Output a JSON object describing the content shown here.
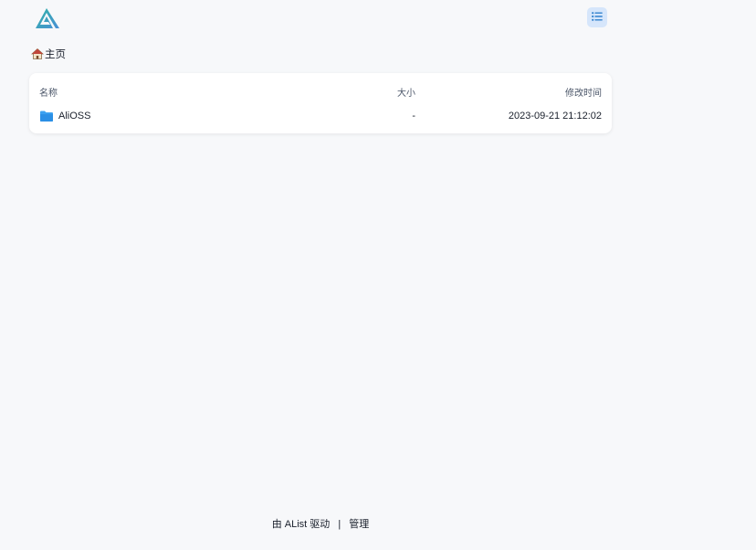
{
  "header": {
    "logo_icon": "alist-logo-icon",
    "layout_toggle_icon": "list-icon",
    "accent_color": "#3182ce"
  },
  "breadcrumb": {
    "home_icon": "house-emoji-icon",
    "home_label": "主页"
  },
  "table": {
    "columns": {
      "name": "名称",
      "size": "大小",
      "modified": "修改时间"
    },
    "rows": [
      {
        "icon": "folder-icon",
        "name": "AliOSS",
        "size": "-",
        "modified": "2023-09-21 21:12:02"
      }
    ]
  },
  "footer": {
    "powered_by": "由 AList 驱动",
    "separator": "|",
    "manage": "管理"
  }
}
